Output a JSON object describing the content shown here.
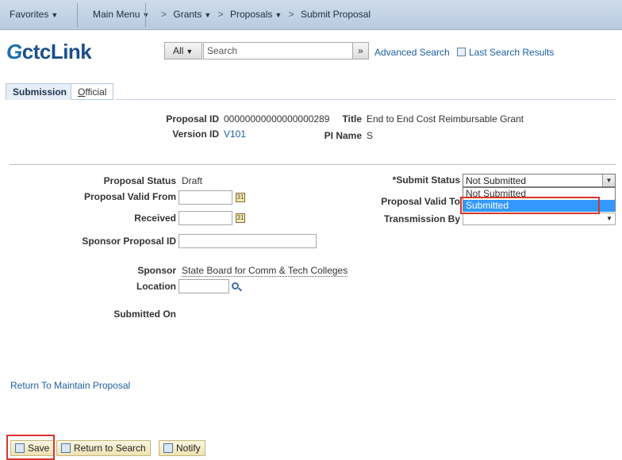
{
  "nav": {
    "favorites": "Favorites",
    "main_menu": "Main Menu",
    "grants": "Grants",
    "proposals": "Proposals",
    "current": "Submit Proposal"
  },
  "logo": {
    "text": "ctcLink",
    "mark": "G"
  },
  "search": {
    "scope": "All",
    "placeholder": "Search",
    "go": "»",
    "advanced": "Advanced Search",
    "last_results": "Last Search Results"
  },
  "tabs": {
    "submission": "Submission",
    "official_first": "O",
    "official_rest": "fficial"
  },
  "proposal": {
    "proposal_id_label": "Proposal ID",
    "proposal_id": "00000000000000000289",
    "version_id_label": "Version ID",
    "version_id": "V101",
    "title_label": "Title",
    "title": "End to End Cost Reimbursable Grant",
    "pi_name_label": "PI Name",
    "pi_name": "S"
  },
  "form": {
    "proposal_status_label": "Proposal Status",
    "proposal_status": "Draft",
    "valid_from_label": "Proposal Valid From",
    "received_label": "Received",
    "sponsor_proposal_id_label": "Sponsor Proposal ID",
    "sponsor_label": "Sponsor",
    "sponsor": "State Board for Comm & Tech Colleges",
    "location_label": "Location",
    "submitted_on_label": "Submitted On",
    "submit_status_label": "*Submit Status",
    "submit_status": "Not Submitted",
    "submit_status_options": [
      "Not Submitted",
      "Submitted"
    ],
    "valid_to_label": "Proposal Valid To",
    "transmission_by_label": "Transmission By"
  },
  "links": {
    "return_maintain": "Return To Maintain Proposal"
  },
  "toolbar": {
    "save": "Save",
    "return_search": "Return to Search",
    "notify": "Notify"
  },
  "colors": {
    "highlight": "#3399ff",
    "callout": "#d9342b",
    "link": "#1d5fa3"
  }
}
